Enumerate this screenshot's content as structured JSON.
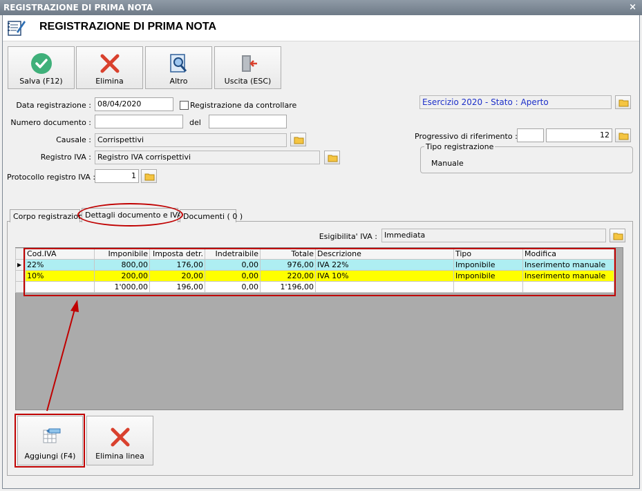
{
  "window": {
    "title": "REGISTRAZIONE DI PRIMA NOTA",
    "close": "×"
  },
  "header": {
    "title": "REGISTRAZIONE DI PRIMA NOTA"
  },
  "toolbar": {
    "save": "Salva (F12)",
    "delete": "Elimina",
    "other": "Altro",
    "exit": "Uscita (ESC)"
  },
  "form": {
    "data_label": "Data registrazione :",
    "data_value": "08/04/2020",
    "check_label": "Registrazione da controllare",
    "numero_label": "Numero documento :",
    "numero_value": "",
    "del_label": "del",
    "del_value": "",
    "causale_label": "Causale :",
    "causale_value": "Corrispettivi",
    "registro_label": "Registro IVA :",
    "registro_value": "Registro IVA corrispettivi",
    "protocollo_label": "Protocollo registro IVA :",
    "protocollo_value": "1"
  },
  "right": {
    "esercizio": "Esercizio 2020 - Stato : Aperto",
    "progressivo_label": "Progressivo di riferimento :",
    "progressivo_a": "",
    "progressivo_b": "12",
    "tipo_group": "Tipo registrazione",
    "tipo_value": "Manuale"
  },
  "tabs": [
    "Corpo registrazione",
    "Dettagli documento e IVA",
    "Documenti ( 0 )"
  ],
  "esigibilita": {
    "label": "Esigibilita' IVA :",
    "value": "Immediata"
  },
  "table": {
    "headers": [
      "Cod.IVA",
      "Imponibile",
      "Imposta detr.",
      "Indetraibile",
      "Totale",
      "Descrizione",
      "Tipo",
      "Modifica"
    ],
    "rows": [
      [
        "22%",
        "800,00",
        "176,00",
        "0,00",
        "976,00",
        "IVA 22%",
        "Imponibile",
        "Inserimento manuale"
      ],
      [
        "10%",
        "200,00",
        "20,00",
        "0,00",
        "220,00",
        "IVA 10%",
        "Imponibile",
        "Inserimento manuale"
      ],
      [
        "",
        "1'000,00",
        "196,00",
        "0,00",
        "1'196,00",
        "",
        "",
        ""
      ]
    ],
    "row_colors": [
      "#aeeef2",
      "#ffff00",
      "#ffffff"
    ]
  },
  "bottom": {
    "add": "Aggiungi (F4)",
    "delete_line": "Elimina linea"
  }
}
